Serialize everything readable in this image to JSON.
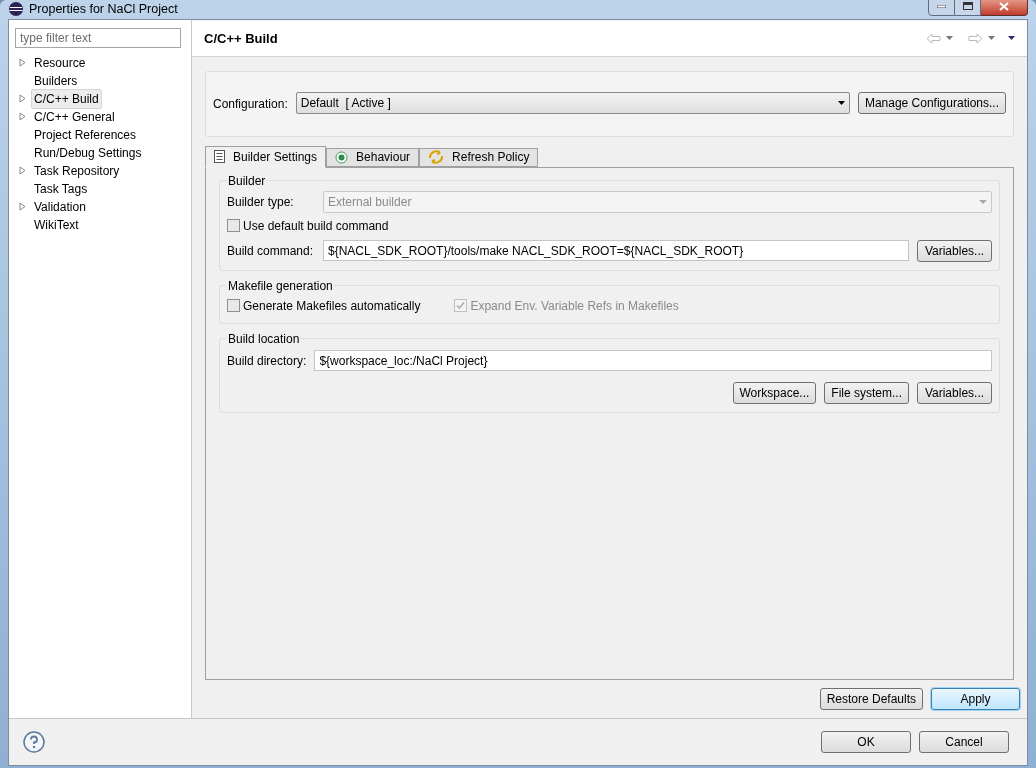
{
  "window": {
    "title": "Properties for NaCl Project"
  },
  "filter": {
    "placeholder": "type filter text"
  },
  "tree": [
    {
      "label": "Resource",
      "expandable": true,
      "selected": false
    },
    {
      "label": "Builders",
      "expandable": false,
      "selected": false
    },
    {
      "label": "C/C++ Build",
      "expandable": true,
      "selected": true
    },
    {
      "label": "C/C++ General",
      "expandable": true,
      "selected": false
    },
    {
      "label": "Project References",
      "expandable": false,
      "selected": false
    },
    {
      "label": "Run/Debug Settings",
      "expandable": false,
      "selected": false
    },
    {
      "label": "Task Repository",
      "expandable": true,
      "selected": false
    },
    {
      "label": "Task Tags",
      "expandable": false,
      "selected": false
    },
    {
      "label": "Validation",
      "expandable": true,
      "selected": false
    },
    {
      "label": "WikiText",
      "expandable": false,
      "selected": false
    }
  ],
  "page_title": "C/C++ Build",
  "configuration": {
    "label": "Configuration:",
    "value": "Default  [ Active ]",
    "button": "Manage Configurations..."
  },
  "tabs": [
    {
      "label": "Builder Settings",
      "kind": "list",
      "selected": true
    },
    {
      "label": "Behaviour",
      "kind": "radio",
      "selected": false
    },
    {
      "label": "Refresh Policy",
      "kind": "refresh",
      "selected": false
    }
  ],
  "groups": [
    {
      "title": "Builder",
      "rows": [
        {
          "kind": "select",
          "label": "Builder type:",
          "value": "External builder",
          "disabled": true
        },
        {
          "kind": "checkbox",
          "label": "Use default build command",
          "checked": false,
          "disabled": false
        },
        {
          "kind": "text",
          "label": "Build command:",
          "value": "${NACL_SDK_ROOT}/tools/make NACL_SDK_ROOT=${NACL_SDK_ROOT}",
          "buttons": [
            "Variables..."
          ]
        }
      ]
    },
    {
      "title": "Makefile generation",
      "rows": [
        {
          "kind": "checkpair",
          "items": [
            {
              "label": "Generate Makefiles automatically",
              "checked": false,
              "disabled": false
            },
            {
              "label": "Expand Env. Variable Refs in Makefiles",
              "checked": true,
              "disabled": true
            }
          ]
        }
      ]
    },
    {
      "title": "Build location",
      "rows": [
        {
          "kind": "text",
          "label": "Build directory:",
          "value": "${workspace_loc:/NaCl Project}",
          "buttons": []
        },
        {
          "kind": "buttons",
          "buttons": [
            "Workspace...",
            "File system...",
            "Variables..."
          ]
        }
      ]
    }
  ],
  "page_buttons": [
    {
      "label": "Restore Defaults",
      "default": false
    },
    {
      "label": "Apply",
      "default": true
    }
  ],
  "dialog_buttons": [
    "OK",
    "Cancel"
  ]
}
